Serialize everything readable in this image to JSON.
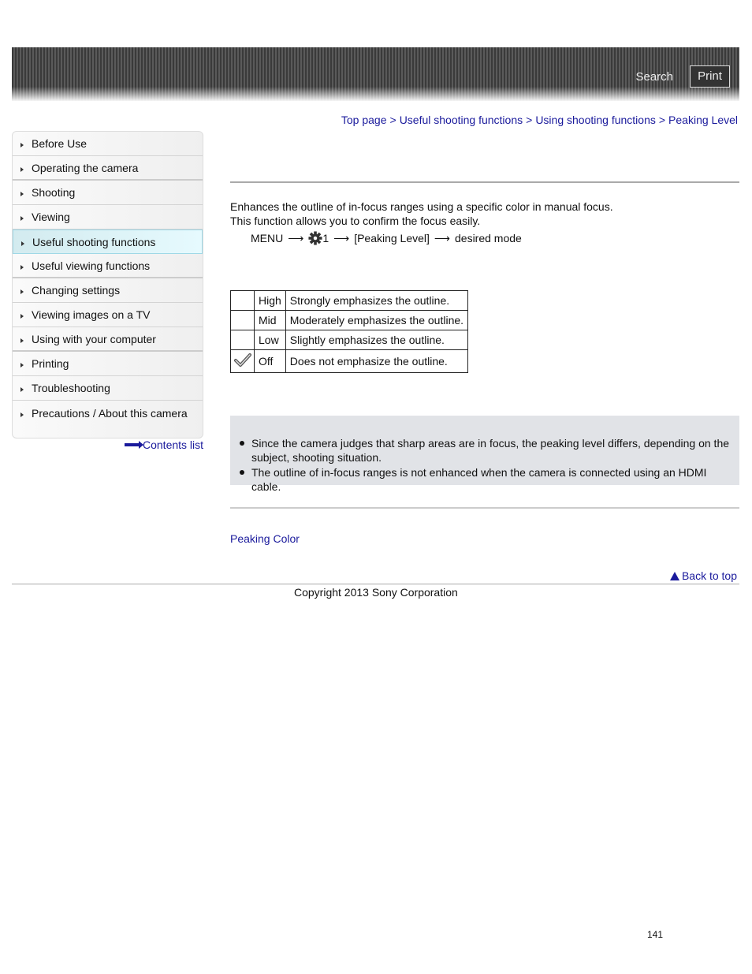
{
  "header": {
    "search_label": "Search",
    "print_label": "Print"
  },
  "breadcrumb": [
    {
      "label": "Top page"
    },
    {
      "label": "Useful shooting functions"
    },
    {
      "label": "Using shooting functions"
    },
    {
      "label": "Peaking Level"
    }
  ],
  "breadcrumb_separator": ">",
  "sidebar": {
    "items": [
      {
        "label": "Before Use"
      },
      {
        "label": "Operating the camera"
      },
      {
        "label": "Shooting"
      },
      {
        "label": "Viewing"
      },
      {
        "label": "Useful shooting functions",
        "active": true
      },
      {
        "label": "Useful viewing functions"
      },
      {
        "label": "Changing settings"
      },
      {
        "label": "Viewing images on a TV"
      },
      {
        "label": "Using with your computer"
      },
      {
        "label": "Printing"
      },
      {
        "label": "Troubleshooting"
      },
      {
        "label": "Precautions / About this camera"
      }
    ],
    "contents_list": "Contents list"
  },
  "main": {
    "intro_line1": "Enhances the outline of in-focus ranges using a specific color in manual focus.",
    "intro_line2": "This function allows you to confirm the focus easily.",
    "menu_path": {
      "menu": "MENU",
      "arrow": "⟶",
      "gear_suffix": "1",
      "item": "[Peaking Level]",
      "final": "desired mode"
    },
    "modes": [
      {
        "default": false,
        "name": "High",
        "description": "Strongly emphasizes the outline."
      },
      {
        "default": false,
        "name": "Mid",
        "description": "Moderately emphasizes the outline."
      },
      {
        "default": false,
        "name": "Low",
        "description": "Slightly emphasizes the outline."
      },
      {
        "default": true,
        "name": "Off",
        "description": "Does not emphasize the outline."
      }
    ],
    "notes": [
      "Since the camera judges that sharp areas are in focus, the peaking level differs, depending on the subject, shooting situation.",
      "The outline of in-focus ranges is not enhanced when the camera is connected using an HDMI cable."
    ],
    "related_link": "Peaking Color",
    "back_to_top": "Back to top"
  },
  "footer": {
    "copyright": "Copyright 2013 Sony Corporation",
    "page_number": "141"
  },
  "colors": {
    "link": "#1a1a9c",
    "active_sidebar": "#e6fafe",
    "note_background": "#e1e3e7"
  }
}
